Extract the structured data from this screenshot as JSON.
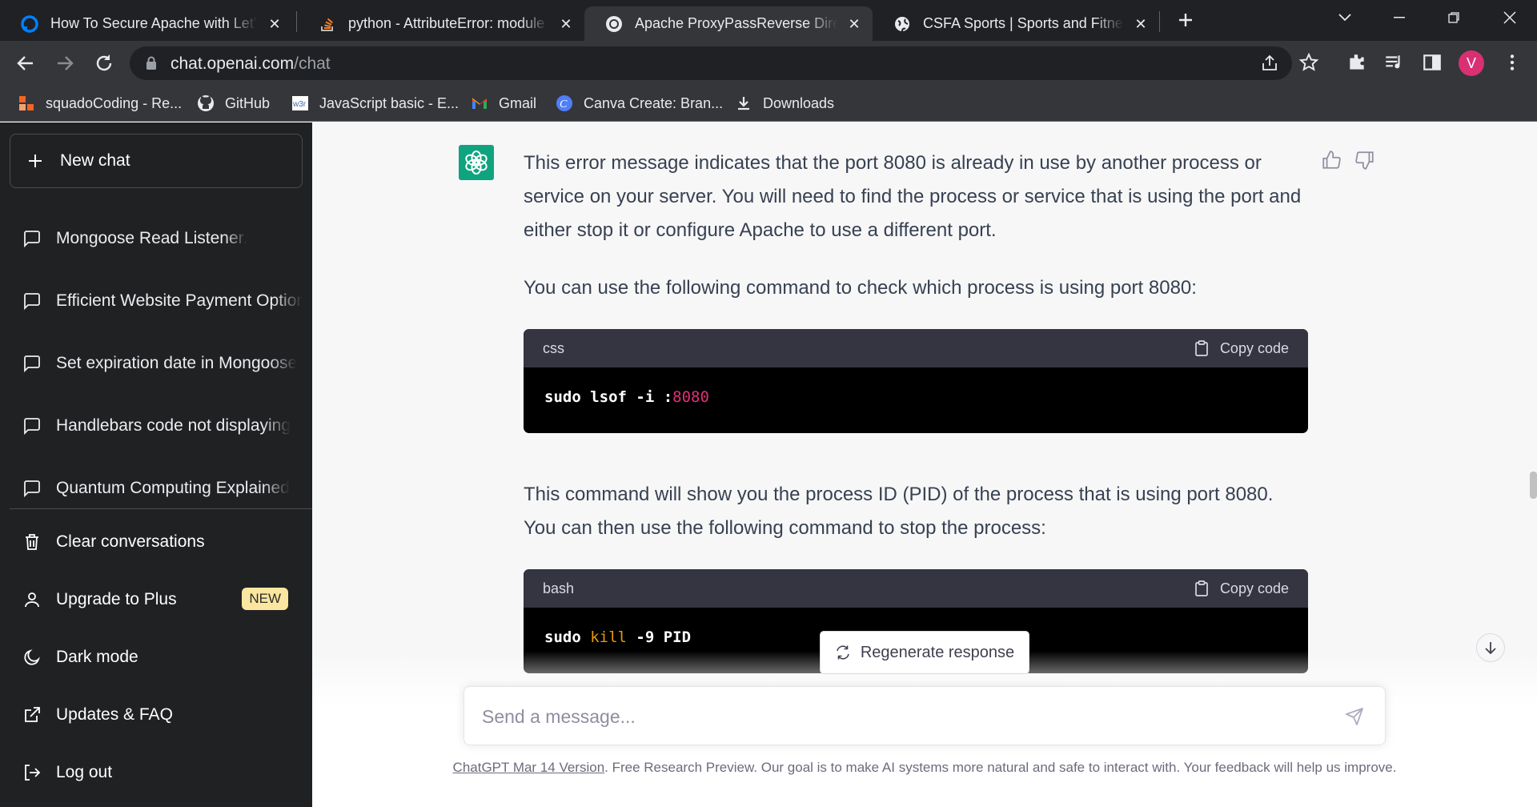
{
  "browser": {
    "tabs": [
      {
        "title": "How To Secure Apache with Let's Encrypt",
        "icon": "digitalocean-icon",
        "active": false
      },
      {
        "title": "python - AttributeError: module 'numpy'",
        "icon": "stackoverflow-icon",
        "active": false
      },
      {
        "title": "Apache ProxyPassReverse Directive",
        "icon": "openai-icon",
        "active": true
      },
      {
        "title": "CSFA Sports | Sports and Fitness Academy",
        "icon": "globe-icon",
        "active": false
      }
    ],
    "address": {
      "host": "chat.openai.com",
      "path": "/chat"
    },
    "profile_initial": "V",
    "profile_color": "#d93073",
    "bookmarks": [
      {
        "label": "squadoCoding - Re...",
        "icon": "squado-icon"
      },
      {
        "label": "GitHub",
        "icon": "github-icon"
      },
      {
        "label": "JavaScript basic - E...",
        "icon": "w3resource-icon"
      },
      {
        "label": "Gmail",
        "icon": "gmail-icon"
      },
      {
        "label": "Canva Create: Bran...",
        "icon": "canva-icon"
      },
      {
        "label": "Downloads",
        "icon": "download-icon"
      }
    ]
  },
  "sidebar": {
    "new_chat": "New chat",
    "history": [
      "Mongoose Read Listener.",
      "Efficient Website Payment Options",
      "Set expiration date in Mongoose",
      "Handlebars code not displaying",
      "Quantum Computing Explained"
    ],
    "menu": {
      "clear": "Clear conversations",
      "upgrade": "Upgrade to Plus",
      "upgrade_badge": "NEW",
      "dark_mode": "Dark mode",
      "updates": "Updates & FAQ",
      "logout": "Log out"
    }
  },
  "chat": {
    "para1": "This error message indicates that the port 8080 is already in use by another process or service on your server. You will need to find the process or service that is using the port and either stop it or configure Apache to use a different port.",
    "para2": "You can use the following command to check which process is using port 8080:",
    "code1": {
      "lang": "css",
      "copy": "Copy code",
      "cmd": "sudo lsof -i :",
      "num": "8080"
    },
    "para3": "This command will show you the process ID (PID) of the process that is using port 8080. You can then use the following command to stop the process:",
    "code2": {
      "lang": "bash",
      "copy": "Copy code",
      "cmd": "sudo ",
      "kw": "kill",
      "rest": " -9 PID"
    },
    "regenerate": "Regenerate response",
    "placeholder": "Send a message...",
    "footer_link": "ChatGPT Mar 14 Version",
    "footer_text": ". Free Research Preview. Our goal is to make AI systems more natural and safe to interact with. Your feedback will help us improve."
  },
  "colors": {
    "sidebar_bg": "#202123",
    "accent": "#10a37f",
    "badge": "#fae69e"
  }
}
